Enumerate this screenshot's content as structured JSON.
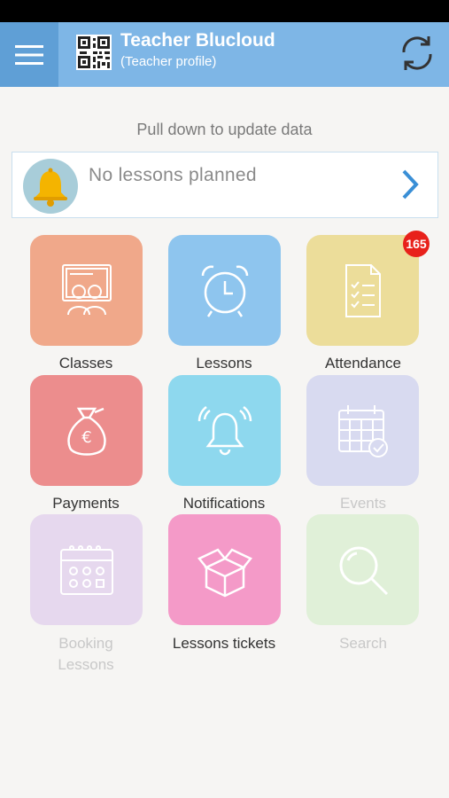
{
  "header": {
    "title": "Teacher Blucloud",
    "subtitle": "(Teacher profile)"
  },
  "hint": "Pull down to update data",
  "lesson_card": {
    "text": "No lessons planned"
  },
  "tiles": [
    {
      "label": "Classes",
      "color": "#f0a88a",
      "icon": "classroom-icon",
      "enabled": true
    },
    {
      "label": "Lessons",
      "color": "#8ec5ee",
      "icon": "alarm-clock-icon",
      "enabled": true
    },
    {
      "label": "Attendance",
      "color": "#ecdd9a",
      "icon": "checklist-icon",
      "enabled": true,
      "badge": "165"
    },
    {
      "label": "Payments",
      "color": "#ec8d8d",
      "icon": "money-bag-icon",
      "enabled": true
    },
    {
      "label": "Notifications",
      "color": "#8ed8ee",
      "icon": "bell-icon",
      "enabled": true
    },
    {
      "label": "Events",
      "color": "#d8daf0",
      "icon": "calendar-check-icon",
      "enabled": false
    },
    {
      "label": "Booking\nLessons",
      "color": "#e6d8ee",
      "icon": "calendar-icon",
      "enabled": false
    },
    {
      "label": "Lessons tickets",
      "color": "#f49ac8",
      "icon": "box-icon",
      "enabled": true
    },
    {
      "label": "Search",
      "color": "#e0f0d8",
      "icon": "search-icon",
      "enabled": false
    }
  ],
  "colors": {
    "header": "#7eb6e6",
    "menu": "#5f9fd6",
    "badge": "#e8211b",
    "accent": "#3a8fd6"
  }
}
